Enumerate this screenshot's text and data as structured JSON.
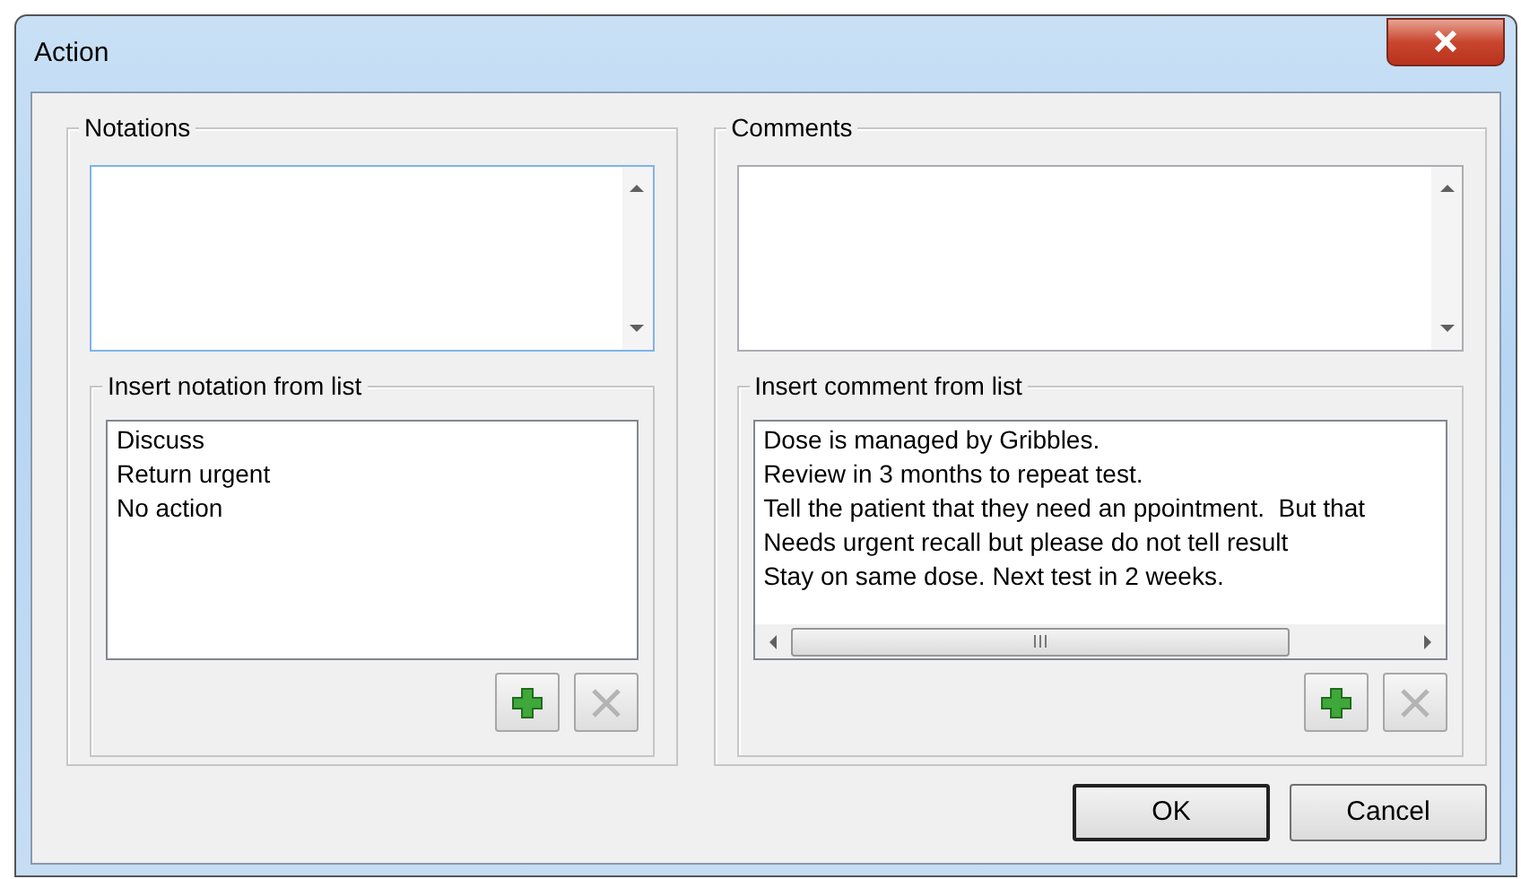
{
  "window": {
    "title": "Action"
  },
  "panels": [
    {
      "title": "Notations",
      "list_group": {
        "title": "Insert notation from list",
        "items": [
          "Discuss",
          "Return urgent",
          "No action"
        ],
        "horizontal_scroll": false
      },
      "add_button": {
        "disabled": false
      },
      "delete_button": {
        "disabled": true
      }
    },
    {
      "title": "Comments",
      "list_group": {
        "title": "Insert comment from list",
        "items": [
          "Dose is managed by Gribbles.",
          "Review in 3 months to repeat test.",
          "Tell the patient that they need an ppointment.  But that",
          "Needs urgent recall but please do not tell result",
          "Stay on same dose. Next test in 2 weeks."
        ],
        "horizontal_scroll": true
      },
      "add_button": {
        "disabled": false
      },
      "delete_button": {
        "disabled": true
      }
    }
  ],
  "buttons": [
    {
      "label": "OK",
      "default": true
    },
    {
      "label": "Cancel",
      "default": false
    }
  ]
}
